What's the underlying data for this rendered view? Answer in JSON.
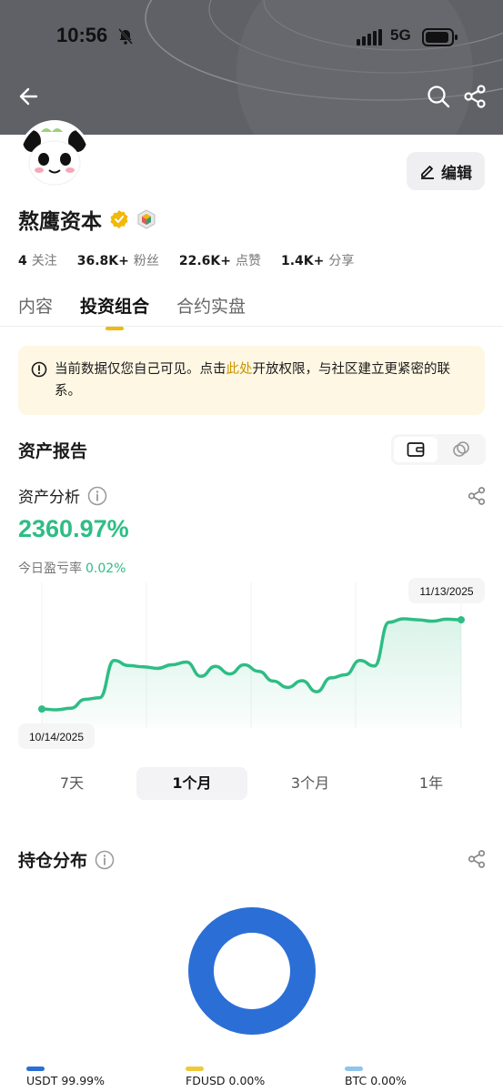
{
  "status_bar": {
    "time": "10:56",
    "network": "5G"
  },
  "profile": {
    "name": "熬鹰资本",
    "edit_label": "编辑",
    "stats": [
      {
        "value": "4",
        "label": "关注"
      },
      {
        "value": "36.8K+",
        "label": "粉丝"
      },
      {
        "value": "22.6K+",
        "label": "点赞"
      },
      {
        "value": "1.4K+",
        "label": "分享"
      }
    ]
  },
  "tabs": [
    {
      "label": "内容",
      "active": false
    },
    {
      "label": "投资组合",
      "active": true
    },
    {
      "label": "合约实盘",
      "active": false
    }
  ],
  "notice": {
    "text_before": "当前数据仅您自己可见。点击",
    "link": "此处",
    "text_after": "开放权限，与社区建立更紧密的联系。"
  },
  "asset_report": {
    "title": "资产报告",
    "analysis_title": "资产分析",
    "value": "2360.97%",
    "daily_label": "今日盈亏率",
    "daily_value": "0.02%"
  },
  "chart_data": {
    "type": "line",
    "start_label": "10/14/2025",
    "end_label": "11/13/2025",
    "x": [
      "10/14/2025",
      "",
      "",
      "",
      "",
      "",
      "",
      "",
      "",
      "",
      "",
      "",
      "",
      "",
      "",
      "",
      "",
      "",
      "",
      "",
      "",
      "",
      "",
      "",
      "",
      "",
      "",
      "",
      "",
      "11/13/2025"
    ],
    "values": [
      0.5,
      0.1,
      0.9,
      5.4,
      6.2,
      25.0,
      22.4,
      21.8,
      21.0,
      22.8,
      24.2,
      17.0,
      22.0,
      18.2,
      22.8,
      19.5,
      14.6,
      11.4,
      14.8,
      9.2,
      16.2,
      17.8,
      25.0,
      22.2,
      44.2,
      46.0,
      45.5,
      44.8,
      45.8,
      45.5
    ],
    "y_format": "percent",
    "colors": {
      "line": "#2ebd85"
    }
  },
  "periods": [
    {
      "label": "7天",
      "active": false
    },
    {
      "label": "1个月",
      "active": true
    },
    {
      "label": "3个月",
      "active": false
    },
    {
      "label": "1年",
      "active": false
    }
  ],
  "holdings": {
    "title": "持仓分布",
    "items": [
      {
        "name": "USDT",
        "pct": "99.99%",
        "color": "#2b6fd6"
      },
      {
        "name": "FDUSD",
        "pct": "0.00%",
        "color": "#f0c93a"
      },
      {
        "name": "BTC",
        "pct": "0.00%",
        "color": "#8fc4ec"
      }
    ]
  }
}
